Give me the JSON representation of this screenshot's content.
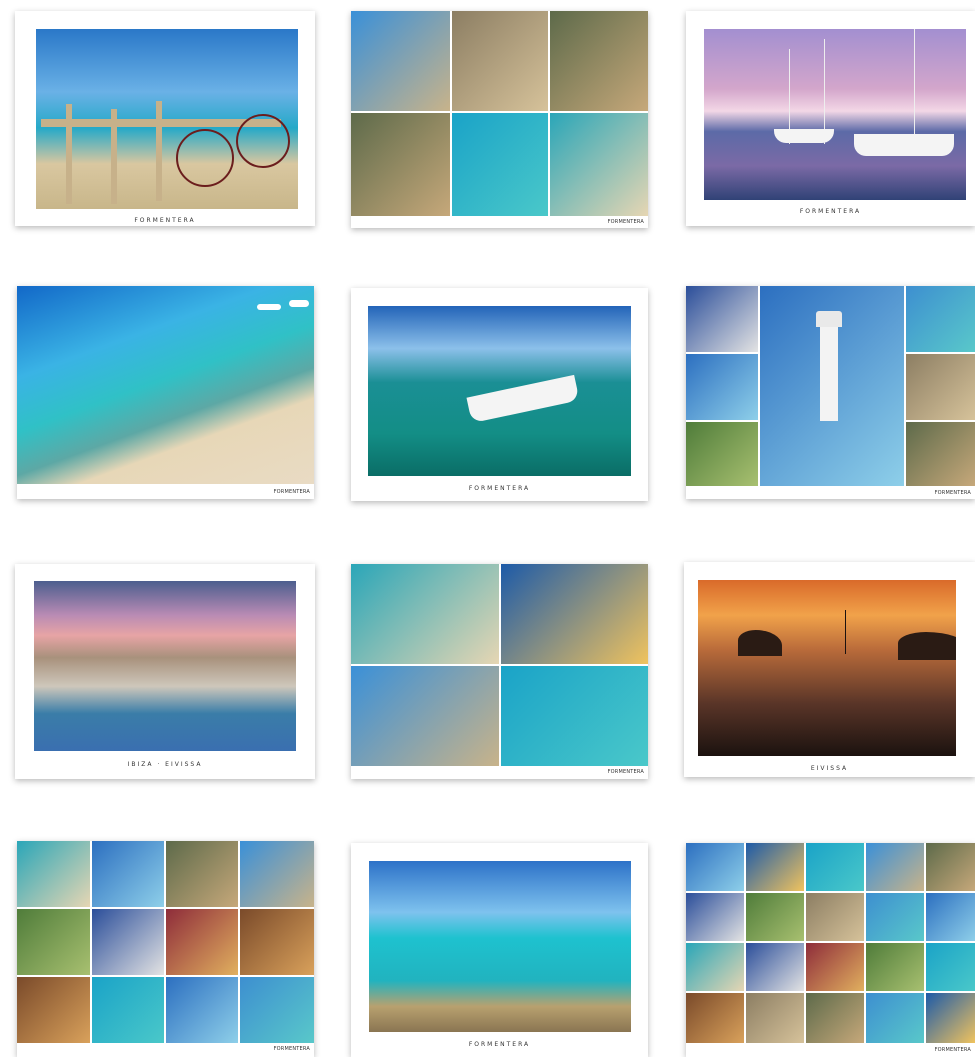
{
  "cards": [
    {
      "caption": "FORMENTERA"
    },
    {
      "caption": "FORMENTERA"
    },
    {
      "caption": "FORMENTERA"
    },
    {
      "caption": "FORMENTERA"
    },
    {
      "caption": "FORMENTERA"
    },
    {
      "caption": "FORMENTERA"
    },
    {
      "caption": "IBIZA · EIVISSA"
    },
    {
      "caption": "FORMENTERA"
    },
    {
      "caption": "EIVISSA"
    },
    {
      "caption": "FORMENTERA"
    },
    {
      "caption": "FORMENTERA"
    },
    {
      "caption": "FORMENTERA"
    }
  ]
}
